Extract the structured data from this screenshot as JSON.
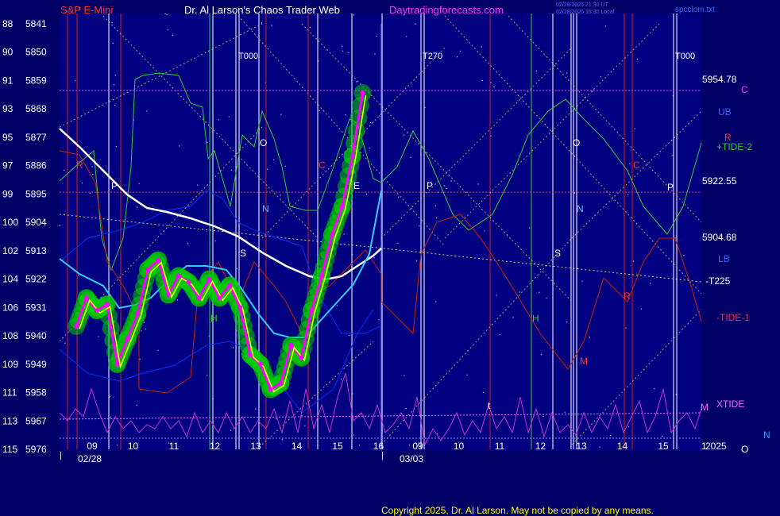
{
  "header": {
    "symbol": "S&P E-Mini",
    "title": "Dr. Al Larson's Chaos Trader Web",
    "site": "Daytradingforecasts.com",
    "stamp_utc": "02/28/2025 21:30 UT",
    "stamp_local": "02/28/2025 15:30 Local",
    "file": "spcclom.txt"
  },
  "footer": {
    "copyright": "Copyright 2025, Dr. Al Larson. May not be copied by any means."
  },
  "colors": {
    "background": "#000066",
    "plot_bg": "#000080",
    "price_line": "#ff00ff",
    "price_glow": "#00cc00",
    "ema": "#ffff00",
    "white_ma": "#ffffff",
    "cyan_ma": "#33ccff",
    "tide2": "#33cc33",
    "tide1": "#cc2200",
    "xtide": "#cc33cc",
    "band": "#0033ff"
  },
  "chart_data": {
    "type": "line",
    "title": "S&P E-Mini",
    "y_axis_left": {
      "price_ticks": [
        5976,
        5967,
        5958,
        5949,
        5940,
        5931,
        5922,
        5913,
        5904,
        5895,
        5886,
        5877,
        5868,
        5859,
        5850,
        5841
      ],
      "index_ticks": [
        115,
        113,
        111,
        109,
        108,
        106,
        104,
        102,
        100,
        99,
        97,
        95,
        93,
        91,
        90,
        88
      ],
      "ylim": [
        5841,
        5976
      ]
    },
    "x_axis": {
      "hour_ticks": [
        "09",
        "10",
        "11",
        "12",
        "13",
        "14",
        "15",
        "16",
        "09",
        "10",
        "11",
        "12",
        "13",
        "14",
        "15",
        "1"
      ],
      "dates": [
        "02/28",
        "03/03"
      ]
    },
    "price_levels": [
      {
        "label": "5954.78",
        "value": 5954.78,
        "line_label": "C",
        "line_color": "#ff33ff"
      },
      {
        "label": "5922.55",
        "value": 5922.55,
        "line_label": "UB",
        "line_color": "#ff3333"
      },
      {
        "label": "5904.68",
        "value": 5904.68,
        "line_label": "LB",
        "line_color": ""
      }
    ],
    "series": [
      {
        "name": "+TIDE-2"
      },
      {
        "name": "-TIDE-1"
      },
      {
        "name": "XTIDE"
      },
      {
        "name": "-T225"
      }
    ],
    "right_labels": [
      "C",
      "UB",
      "R",
      "+TIDE-2",
      "LB",
      "-T225",
      "-TIDE-1",
      "M",
      "XTIDE",
      "2025",
      "N",
      "O"
    ],
    "time_markers": [
      "T000",
      "T270",
      "T000"
    ],
    "annotations": [
      "R",
      "P",
      "C",
      "O",
      "N",
      "S",
      "H",
      "P",
      "O",
      "N",
      "S",
      "H",
      "C",
      "P",
      "R",
      "M",
      "E",
      "t"
    ],
    "price": {
      "day1_x": [
        0,
        0.25,
        0.5,
        0.75,
        1,
        1.25,
        1.5,
        1.75,
        2,
        2.25,
        2.5,
        2.75,
        3,
        3.25,
        3.5,
        3.75,
        4,
        4.25,
        4.5,
        4.75,
        5,
        5.25,
        5.5,
        5.75,
        6,
        6.25,
        6.5,
        6.75,
        7
      ],
      "day1_values": [
        5880,
        5889,
        5885,
        5887,
        5868,
        5876,
        5884,
        5898,
        5901,
        5890,
        5896,
        5894,
        5889,
        5895,
        5889,
        5893,
        5886,
        5871,
        5868,
        5860,
        5862,
        5874,
        5870,
        5885,
        5896,
        5909,
        5918,
        5934,
        5954
      ]
    }
  }
}
